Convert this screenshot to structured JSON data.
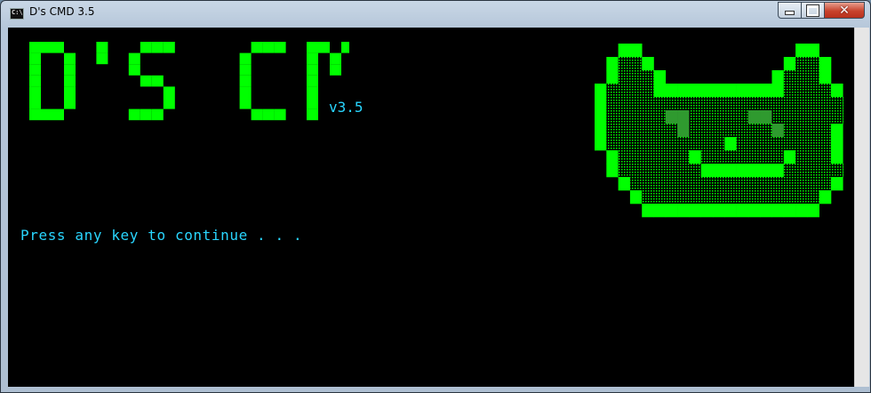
{
  "window": {
    "title": "D's CMD 3.5",
    "app_icon_text": "C:\\",
    "controls": {
      "minimize": "minimize",
      "maximize": "maximize",
      "close": "close"
    }
  },
  "console": {
    "logo_text": "D'S CMD",
    "version": "v3.5",
    "prompt": "Press any key to continue . . .",
    "colors": {
      "logo": "#00ff00",
      "text": "#29d6ff",
      "background": "#000000"
    }
  },
  "mascot": {
    "icon": "pixel-cat-face-icon",
    "color": "#00ff00"
  }
}
